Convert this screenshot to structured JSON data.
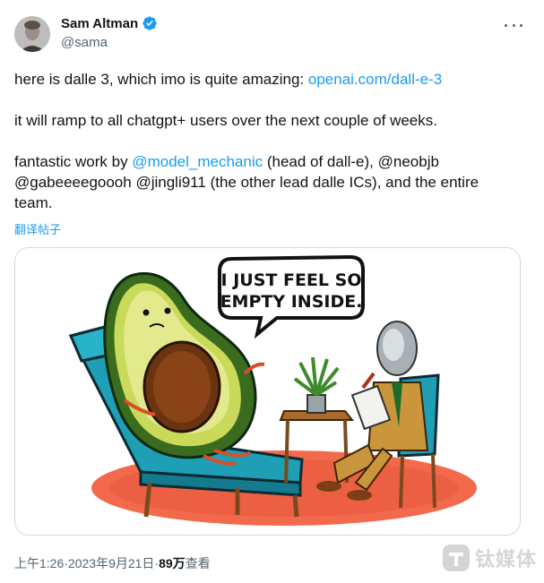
{
  "author": {
    "display_name": "Sam Altman",
    "handle": "@sama",
    "verified": true
  },
  "tweet": {
    "para1_text": "here is dalle 3, which imo is quite amazing: ",
    "para1_link": "openai.com/dall-e-3",
    "para2": "it will ramp to all chatgpt+ users over the next couple of weeks.",
    "para3_pre": "fantastic work by ",
    "para3_mention1": "@model_mechanic",
    "para3_mid1": " (head of dall-e), ",
    "para3_mention2": "@neobjb",
    "para3_mention3": "@gabeeeegoooh",
    "para3_mention4": "@jingli911",
    "para3_end": " (the other lead dalle ICs), and the entire team."
  },
  "translate_label": "翻译帖子",
  "media": {
    "speech_bubble_line1": "I JUST FEEL SO",
    "speech_bubble_line2": "EMPTY INSIDE."
  },
  "meta": {
    "time": "上午1:26",
    "separator": " · ",
    "date": "2023年9月21日",
    "views_count": "89万",
    "views_label": " 查看"
  },
  "watermark": {
    "text": "钛媒体"
  },
  "colors": {
    "link": "#1d9bf0",
    "text": "#0f1419",
    "secondary": "#536471"
  },
  "icons": {
    "verified": "verified-badge-icon",
    "more": "more-options-icon"
  }
}
